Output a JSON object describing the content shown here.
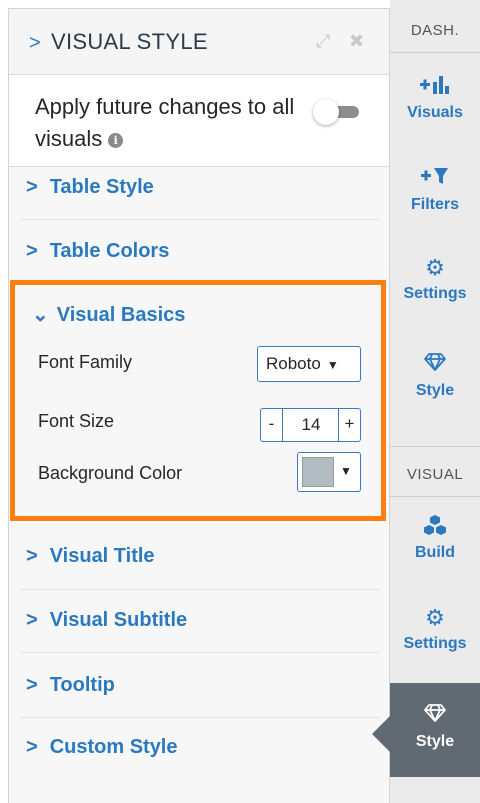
{
  "panel": {
    "title": "VISUAL STYLE",
    "title_chevron": ">",
    "expand_icon": "⤢",
    "close_icon": "✖"
  },
  "apply_future": {
    "label": "Apply future changes to all visuals",
    "info_icon": "i",
    "toggle_on": false
  },
  "sections": {
    "table_style": {
      "chevron": ">",
      "label": "Table Style"
    },
    "table_colors": {
      "chevron": ">",
      "label": "Table Colors"
    },
    "visual_basics": {
      "chevron": "⌄",
      "label": "Visual Basics"
    },
    "visual_title": {
      "chevron": ">",
      "label": "Visual Title"
    },
    "visual_subtitle": {
      "chevron": ">",
      "label": "Visual Subtitle"
    },
    "tooltip": {
      "chevron": ">",
      "label": "Tooltip"
    },
    "custom_style": {
      "chevron": ">",
      "label": "Custom Style"
    }
  },
  "visual_basics": {
    "font_family_label": "Font Family",
    "font_family_value": "Roboto",
    "font_size_label": "Font Size",
    "font_size_value": "14",
    "minus": "-",
    "plus": "+",
    "bg_color_label": "Background Color",
    "bg_color_value": "#b2bcc2"
  },
  "sidebar": {
    "dash_label": "DASH.",
    "visual_label": "VISUAL",
    "dash_items": [
      {
        "icon": "add-chart-icon",
        "label": "Visuals"
      },
      {
        "icon": "add-filter-icon",
        "label": "Filters"
      },
      {
        "icon": "gears-icon",
        "label": "Settings"
      },
      {
        "icon": "diamond-icon",
        "label": "Style"
      }
    ],
    "visual_items": [
      {
        "icon": "cubes-icon",
        "label": "Build"
      },
      {
        "icon": "gears-icon",
        "label": "Settings"
      },
      {
        "icon": "diamond-icon",
        "label": "Style",
        "active": true
      }
    ]
  },
  "colors": {
    "accent": "#2a79c0",
    "highlight": "#ff7f0e",
    "active_tab": "#616a72"
  }
}
